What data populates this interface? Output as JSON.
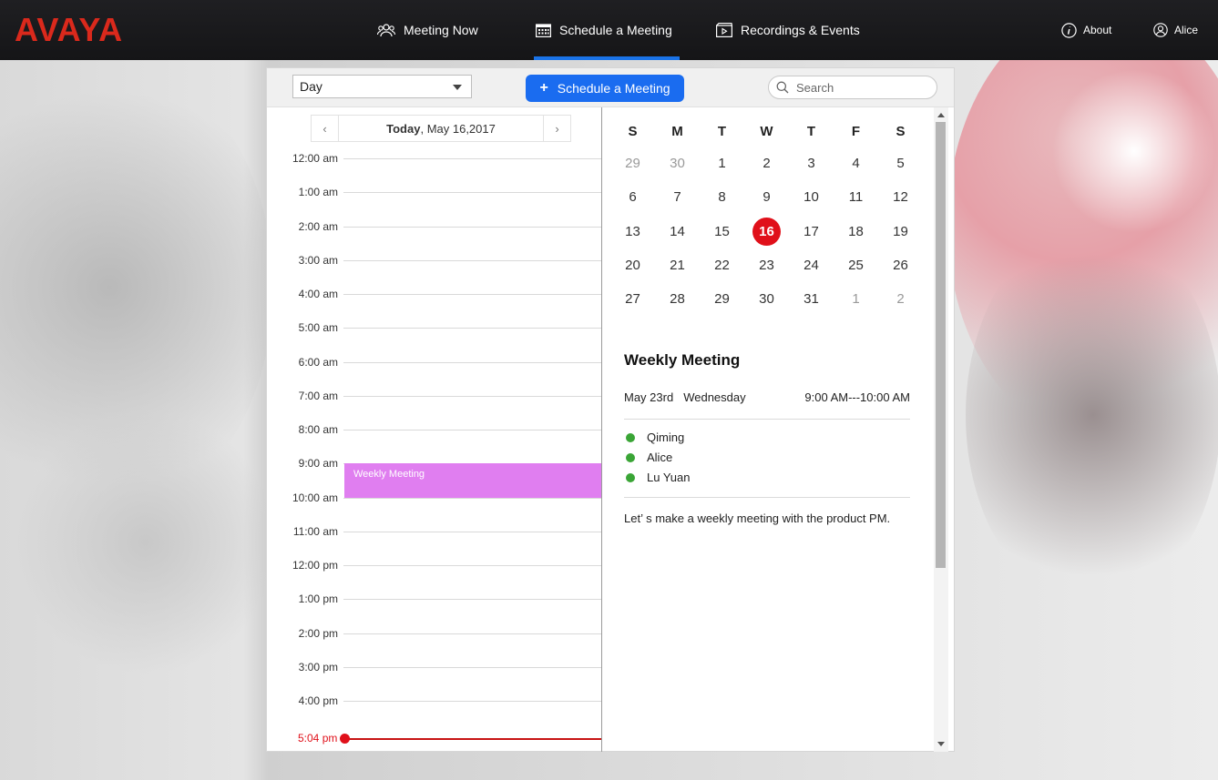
{
  "brand": {
    "logo_text": "AVAYA",
    "logo_color": "#da291c",
    "accent_color": "#1a6cf0"
  },
  "nav": {
    "items": [
      {
        "label": "Meeting Now",
        "icon": "people-icon",
        "active": false
      },
      {
        "label": "Schedule a Meeting",
        "icon": "calendar-icon",
        "active": true
      },
      {
        "label": "Recordings & Events",
        "icon": "film-icon",
        "active": false
      }
    ],
    "about_label": "About",
    "user_label": "Alice"
  },
  "toolbar": {
    "view_select_value": "Day",
    "schedule_button_label": "Schedule a Meeting",
    "search_placeholder": "Search"
  },
  "day_view": {
    "date_prefix": "Today",
    "date_rest": ", May 16,2017",
    "hours": [
      "12:00 am",
      "1:00 am",
      "2:00 am",
      "3:00 am",
      "4:00 am",
      "5:00 am",
      "6:00 am",
      "7:00 am",
      "8:00 am",
      "9:00 am",
      "10:00 am",
      "11:00 am",
      "12:00 pm",
      "1:00 pm",
      "2:00 pm",
      "3:00 pm",
      "4:00 pm"
    ],
    "event_title": "Weekly Meeting",
    "current_time": "5:04 pm"
  },
  "month_view": {
    "weekdays": [
      "S",
      "M",
      "T",
      "W",
      "T",
      "F",
      "S"
    ],
    "weeks": [
      [
        "29",
        "30",
        "1",
        "2",
        "3",
        "4",
        "5"
      ],
      [
        "6",
        "7",
        "8",
        "9",
        "10",
        "11",
        "12"
      ],
      [
        "13",
        "14",
        "15",
        "16",
        "17",
        "18",
        "19"
      ],
      [
        "20",
        "21",
        "22",
        "23",
        "24",
        "25",
        "26"
      ],
      [
        "27",
        "28",
        "29",
        "30",
        "31",
        "1",
        "2"
      ]
    ],
    "selected_day": "16"
  },
  "meeting_detail": {
    "title": "Weekly Meeting",
    "date": "May 23rd",
    "weekday": "Wednesday",
    "time": "9:00 AM---10:00 AM",
    "attendees": [
      "Qiming",
      "Alice",
      "Lu Yuan"
    ],
    "note": "Let’ s make a weekly meeting with the product PM."
  }
}
